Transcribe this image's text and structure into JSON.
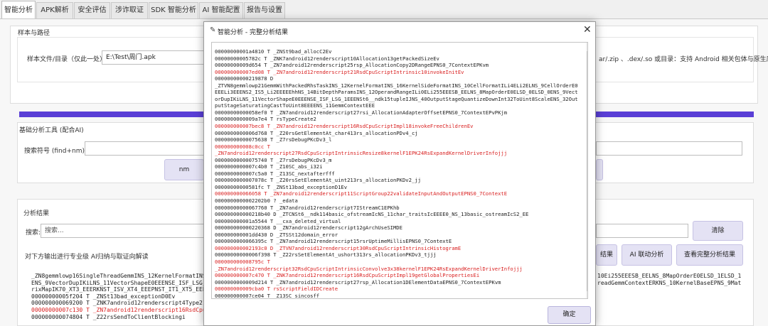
{
  "tabs": [
    "智能分析",
    "APK解析",
    "安全评估",
    "涉诈取证",
    "SDK 智能分析",
    "AI 智能配置",
    "报告与设置"
  ],
  "section_path": {
    "title": "样本与路径",
    "file_label": "样本文件/目录（仅此一处）:",
    "file_value": "E:\\Test\\周门.apk",
    "hint": "ar/.zip 、.dex/.so 或目录：支持 Android 相关包体与原生库)"
  },
  "section_tools": {
    "title": "基础分析工具 (配合AI)",
    "search_label": "搜索符号 (find+nm):",
    "search_value": "",
    "nm_button": "nm"
  },
  "section_results": {
    "title": "分析结果",
    "search_label": "搜索:",
    "search_placeholder": "搜索...",
    "clear_button": "清除",
    "note": "对下方输出进行专业级 AI归纳与取证向解读",
    "btn_results": "结果",
    "btn_ai_link": "AI 联动分析",
    "btn_view_full": "查看完整分析结果"
  },
  "progress": {
    "fill_percent": 100
  },
  "background_log": [
    {
      "text": "_ZN8gemmlowp16SingleThreadGemmINS_12KernelFormatINS_16",
      "red": false
    },
    {
      "text": "ENS_9VectorDupIKiLNS_11VectorShapeE0EEENSE_ISF_LSG_1EE",
      "red": false
    },
    {
      "text": "rixMapIK70_XT3_EEERKNST_ISV_XT4_EEEPNST_IT1_XT5_EEERKT",
      "red": false
    },
    {
      "text": "00000000005f204 T _ZNSt13bad_exceptionD0Ev",
      "red": false
    },
    {
      "text": "000000000069200 T _ZNK7android12renderscript4Type21ca",
      "red": false
    },
    {
      "text": "00000000007c130 T _ZN7android12renderscript16RsdCpuSc",
      "red": true
    },
    {
      "text": "000000000074804 T _Z22rsSendToClientBlockingi",
      "red": false
    }
  ],
  "background_log_right": [
    "10Ei255EEESB_EELNS_8MapOrderE0ELSD_1ELSD_1",
    "readGemmContextERKNS_10KernelBaseEPNS_9Mat"
  ],
  "dialog": {
    "title": "智能分析 - 完整分析结果",
    "ok_button": "确定",
    "lines": [
      {
        "text": "00000000001a4810 T _ZNSt9bad_allocC2Ev",
        "red": false,
        "wrap": false
      },
      {
        "text": "00000000005782c T _ZNK7android12renderscript10Allocation13getPackedSizeEv",
        "red": false,
        "wrap": false
      },
      {
        "text": "00000000009d654 T _ZN7android12renderscript25rsp_AllocationCopy2DRangeEPNS0_7ContextEPKvm",
        "red": false,
        "wrap": false
      },
      {
        "text": "000000000007ed08 T _ZN7android12renderscript21RsdCpuScriptIntrinsic10invokeInitEv",
        "red": true,
        "wrap": false
      },
      {
        "text": "00000000000219878 D",
        "red": false,
        "wrap": false
      },
      {
        "text": "_ZTVN8gemmlowp21GemmWithPackedRhsTaskINS_12KernelFormatINS_16KernelSideFormatINS_10CellFormatILi4ELi2ELNS_9CellOrderE0EEELi3EEENS2_IS5_Li2EEEEEhhNS_14BitDepthParamsINS_12OperandRangeILi0ELi255EEESB_EELNS_8MapOrderE0ELSD_0ELSD_0ENS_9VectorDupIKiLNS_11VectorShapeE0EEENSE_ISF_LSG_1EEENSt6__ndk15tupleIJNS_40OutputStageQuantizeDownInt32ToUint8ScaleENS_32OutputStageSaturatingCastToUint8EEEENS_11GemmContextEEE",
        "red": false,
        "wrap": true
      },
      {
        "text": "00000000000058ef0 T _ZN7android12renderscript27rsi_AllocationAdapterOffsetEPNS0_7ContextEPvPKjm",
        "red": false,
        "wrap": false
      },
      {
        "text": "0000000000009a7e4 T rsTypeCreate2",
        "red": false,
        "wrap": false
      },
      {
        "text": "000000000007bec8 T _ZN7android12renderscript16RsdCpuScriptImpl18invokeFreeChildrenEv",
        "red": true,
        "wrap": false
      },
      {
        "text": "0000000000006d768 T _Z20rsGetElementAt_char413rs_allocationPDv4_cj",
        "red": false,
        "wrap": false
      },
      {
        "text": "00000000000075638 T _Z7rsDebugPKcDv3_l",
        "red": false,
        "wrap": false
      },
      {
        "text": "000000000008c0cc T",
        "red": true,
        "wrap": false
      },
      {
        "text": "_ZN7android12renderscript27RsdCpuScriptIntrinsicResize8kernelF1EPK24RsExpandKernelDriverInfojjj",
        "red": true,
        "wrap": false
      },
      {
        "text": "00000000000075740 T _Z7rsDebugPKcDv3_m",
        "red": false,
        "wrap": false
      },
      {
        "text": "0000000000007c4b0 T _Z10SC_abs_i32i",
        "red": false,
        "wrap": false
      },
      {
        "text": "0000000000007c5a0 T _Z13SC_nextafterfff",
        "red": false,
        "wrap": false
      },
      {
        "text": "0000000000007078c T _Z20rsSetElementAt_uint213rs_allocationPKDv2_jj",
        "red": false,
        "wrap": false
      },
      {
        "text": "00000000000581fc T _ZNSt13bad_exceptionD1Ev",
        "red": false,
        "wrap": false
      },
      {
        "text": "000000000066058 T _ZN7android12renderscript11ScriptGroup22validateInputAndOutputEPNS0_7ContextE",
        "red": true,
        "wrap": false
      },
      {
        "text": "0000000000002202b0 ? _edata",
        "red": false,
        "wrap": false
      },
      {
        "text": "00000000000067760 T _ZN7android12renderscript7IStreamC1EPKhb",
        "red": false,
        "wrap": false
      },
      {
        "text": "000000000000218b40 D _ZTCNSt6__ndk114basic_ofstreamIcNS_11char_traitsIcEEEE0_NS_13basic_ostreamIcS2_EE",
        "red": false,
        "wrap": false
      },
      {
        "text": "000000000001a5544 T __cxa_deleted_virtual",
        "red": false,
        "wrap": false
      },
      {
        "text": "000000000000220368 D _ZN7android12renderscript12gArchUseSIMDE",
        "red": false,
        "wrap": false
      },
      {
        "text": "000000000001dd430 D _ZTSSt12domain_error",
        "red": false,
        "wrap": false
      },
      {
        "text": "0000000000066395c T _ZN7android12renderscript15rsrUptimeMillisEPNS0_7ContextE",
        "red": false,
        "wrap": false
      },
      {
        "text": "000000000002193c0 D _ZTVN7android12renderscript30RsdCpuScriptIntrinsicHistogramE",
        "red": true,
        "wrap": false
      },
      {
        "text": "00000000000006f398 T _Z22rsSetElementAt_ushort313rs_allocationPKDv3_tjjj",
        "red": false,
        "wrap": false
      },
      {
        "text": "000000000008795c T",
        "red": true,
        "wrap": false
      },
      {
        "text": "_ZN7android12renderscript32RsdCpuScriptIntrinsicConvolve3x38kernelF1EPK24RsExpandKernelDriverInfojjj",
        "red": true,
        "wrap": false
      },
      {
        "text": "000000000007c470 T _ZNK7android12renderscript16RsdCpuScriptImpl19getGlobalPropertiesEi",
        "red": true,
        "wrap": false
      },
      {
        "text": "0000000000009d214 T _ZN7android12renderscript27rsp_Allocation1DElementDataEPNS0_7ContextEPKvm",
        "red": false,
        "wrap": false
      },
      {
        "text": "000000000009cba0 T rsScriptFieldIDCreate",
        "red": true,
        "wrap": false
      },
      {
        "text": "000000000007ce04 T _Z13SC_sincosff",
        "red": false,
        "wrap": false
      }
    ]
  }
}
